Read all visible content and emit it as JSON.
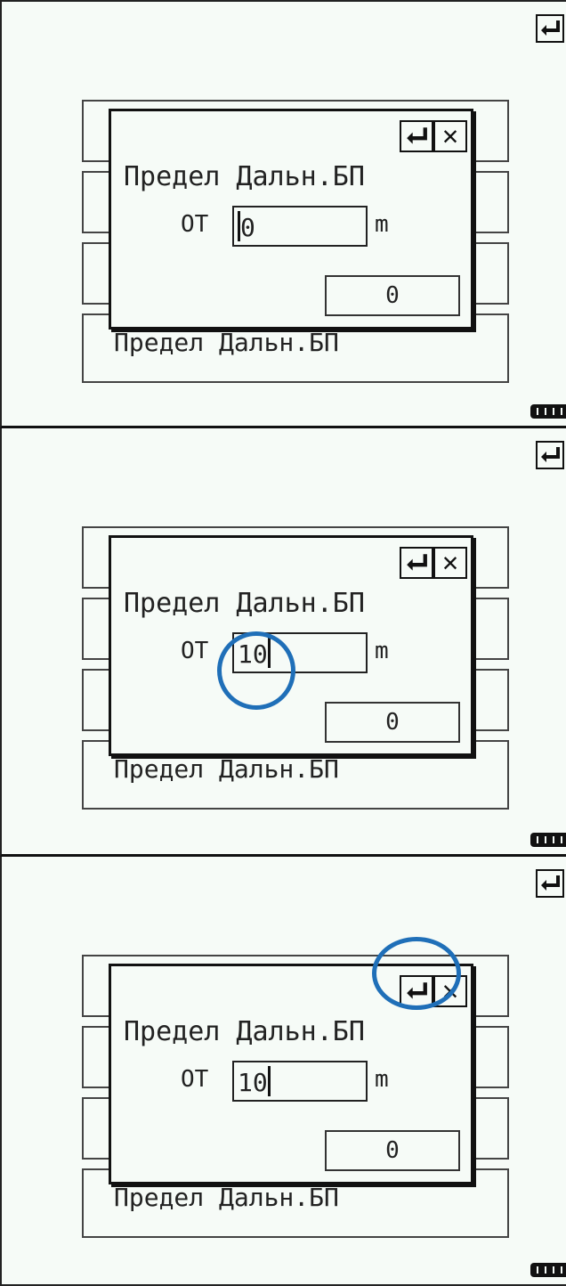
{
  "menu_item_label": "Предел Дальн.БП",
  "dialog": {
    "title": "Предел Дальн.БП",
    "field_label": "ОТ",
    "unit": "m",
    "button_label": "0"
  },
  "steps": [
    {
      "input_value": "0"
    },
    {
      "input_value": "10"
    },
    {
      "input_value": "10"
    }
  ],
  "colors": {
    "screen_bg": "#f6fbf7",
    "highlight": "#1f6fb8"
  },
  "icons": [
    "enter-icon",
    "close-icon",
    "battery-icon"
  ]
}
